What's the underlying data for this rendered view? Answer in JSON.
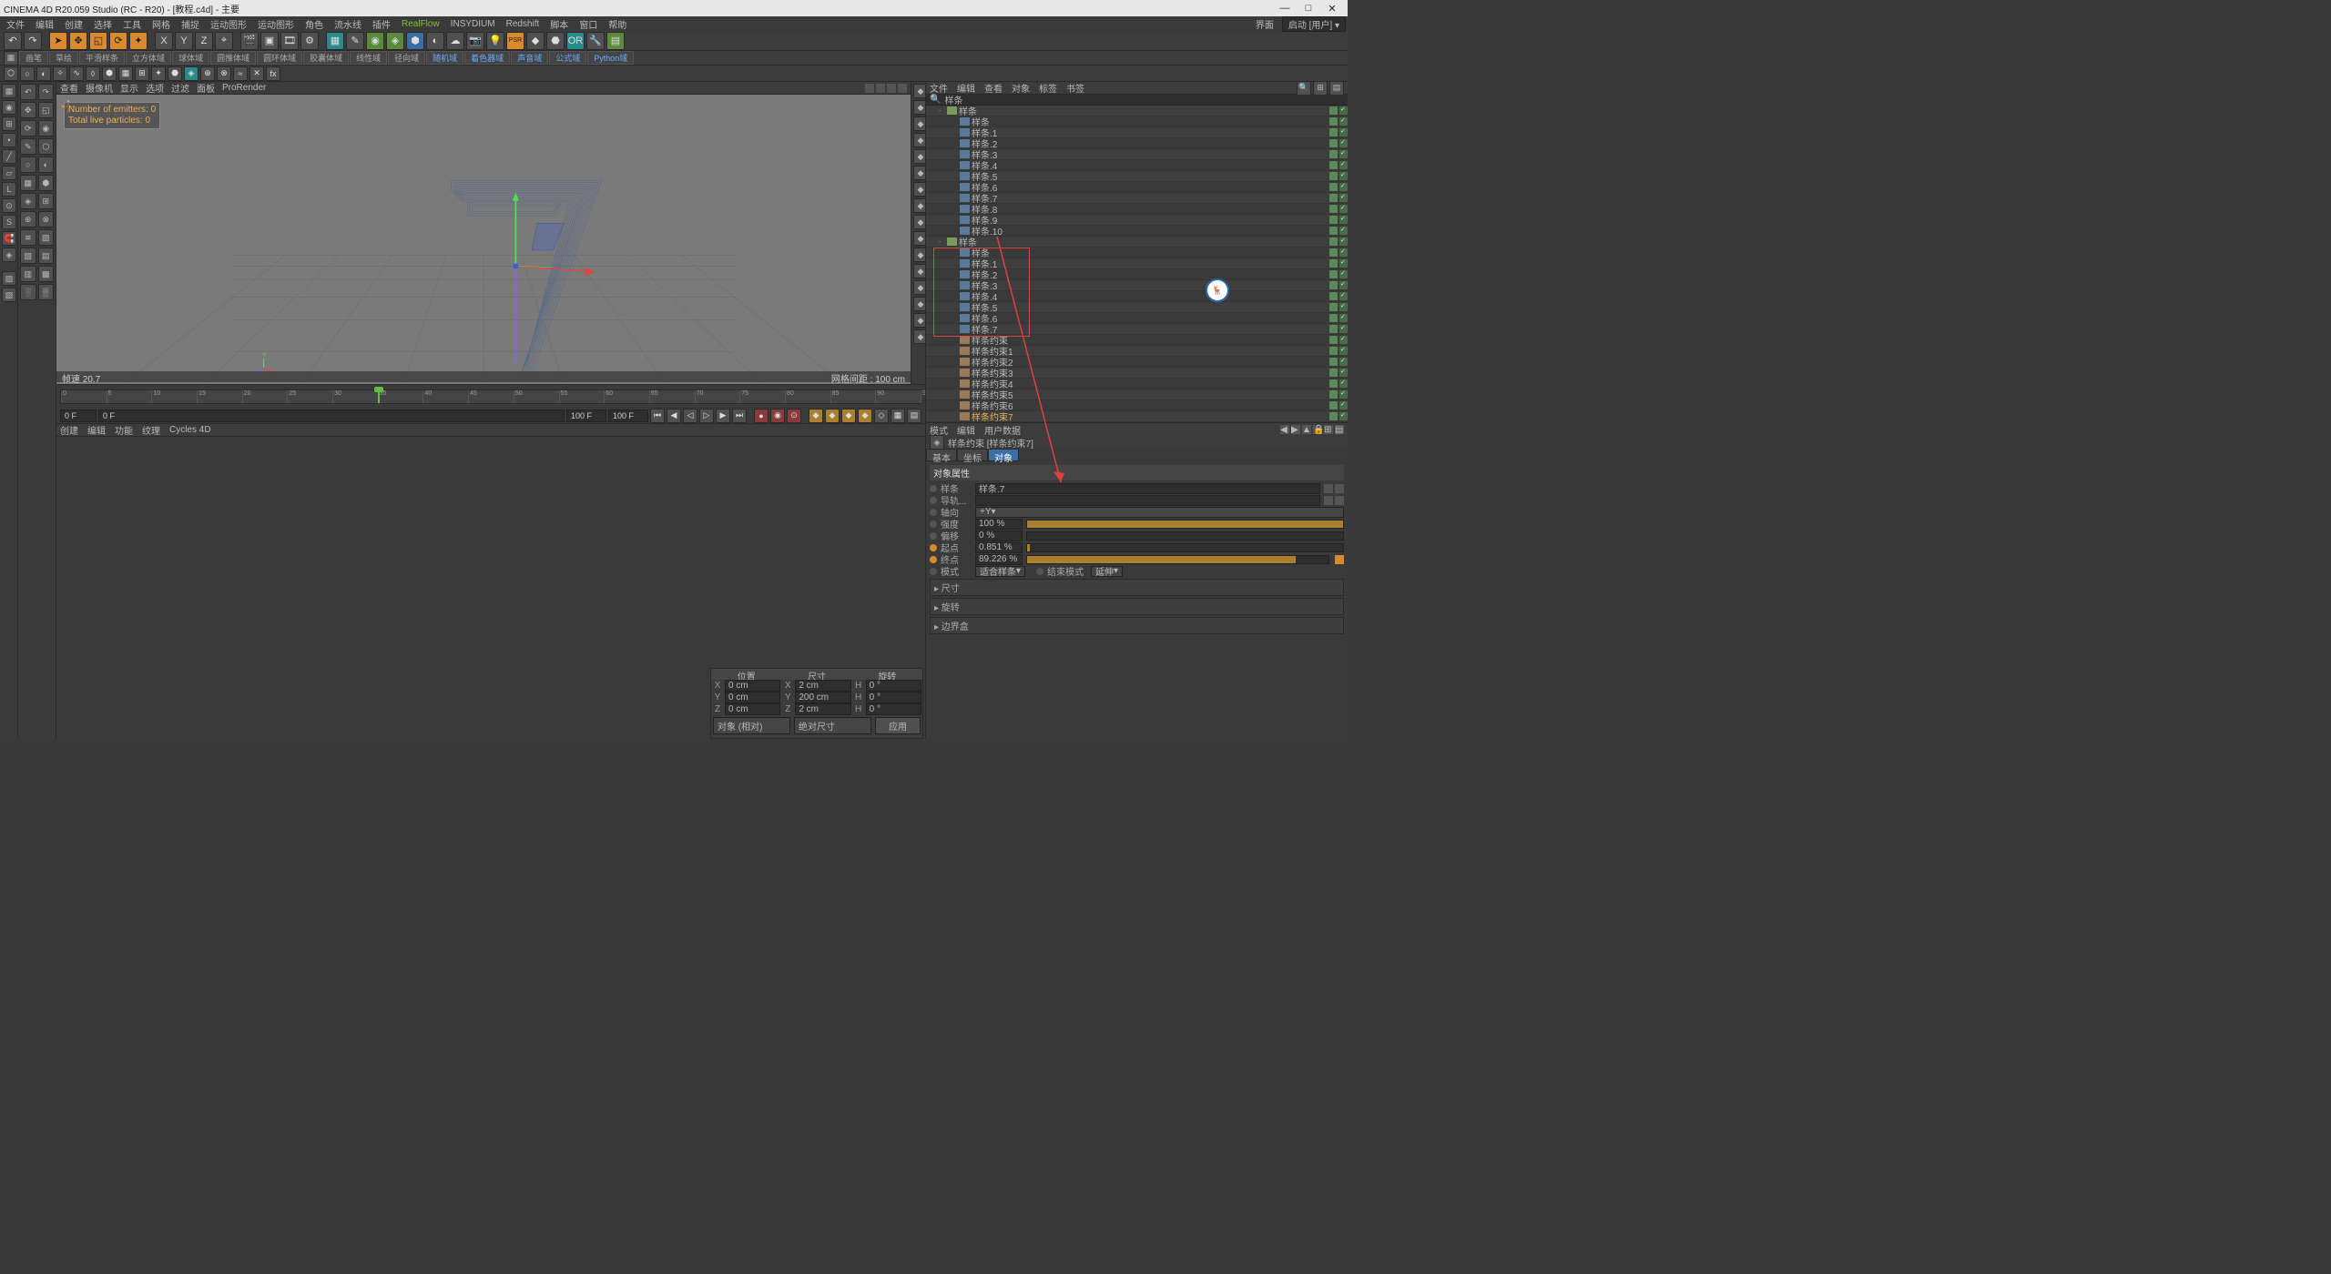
{
  "window": {
    "title": "CINEMA 4D R20.059 Studio (RC - R20) - [教程.c4d] - 主要",
    "btn_min": "—",
    "btn_max": "□",
    "btn_close": "✕"
  },
  "menubar": {
    "items": [
      "文件",
      "编辑",
      "创建",
      "选择",
      "工具",
      "网格",
      "捕捉",
      "运动图形",
      "运动图形",
      "角色",
      "流水线",
      "插件",
      "RealFlow",
      "INSYDIUM",
      "Redshift",
      "脚本",
      "窗口",
      "帮助"
    ],
    "layout_label": "界面",
    "layout_value": "启动 [用户]"
  },
  "splinebar": {
    "items": [
      "画笔",
      "草绘",
      "平滑样条",
      "立方体域",
      "球体域",
      "圆推体域",
      "圆环体域",
      "胶囊体域",
      "线性域",
      "径向域",
      "随机域",
      "着色器域",
      "声音域",
      "公式域",
      "Python域"
    ]
  },
  "viewport": {
    "menu": [
      "查看",
      "摄像机",
      "显示",
      "选项",
      "过滤",
      "面板",
      "ProRender"
    ],
    "info_emitters": "Number of emitters: 0",
    "info_particles": "Total live particles: 0",
    "status_left": "帧速  20.7",
    "status_right": "网格间距 : 100 cm"
  },
  "timeline": {
    "start": 0,
    "end": 95,
    "current": 35,
    "field_start": "0 F",
    "field_cur": "0 F",
    "field_endin": "100 F",
    "field_end": "100 F"
  },
  "bottom_tabs": [
    "创建",
    "编辑",
    "功能",
    "纹理",
    "Cycles 4D"
  ],
  "coord": {
    "hdr": [
      "位置",
      "尺寸",
      "旋转"
    ],
    "rows": [
      {
        "axis": "X",
        "pos": "0 cm",
        "size": "2 cm",
        "rot": "0 °"
      },
      {
        "axis": "Y",
        "pos": "0 cm",
        "size": "200 cm",
        "rot": "0 °"
      },
      {
        "axis": "Z",
        "pos": "0 cm",
        "size": "2 cm",
        "rot": "0 °"
      }
    ],
    "mode1": "对象 (相对)",
    "mode2": "绝对尺寸",
    "apply": "应用"
  },
  "obj_panel": {
    "menu": [
      "文件",
      "编辑",
      "查看",
      "对象",
      "标签",
      "书签"
    ],
    "search": "样条",
    "tree": [
      {
        "d": 0,
        "exp": "-",
        "ic": "grp",
        "nm": "样条",
        "tags": [
          "g",
          "chk"
        ]
      },
      {
        "d": 1,
        "exp": "",
        "ic": "spl",
        "nm": "样条",
        "tags": [
          "g",
          "chk"
        ]
      },
      {
        "d": 1,
        "exp": "",
        "ic": "spl",
        "nm": "样条.1",
        "tags": [
          "g",
          "chk"
        ]
      },
      {
        "d": 1,
        "exp": "",
        "ic": "spl",
        "nm": "样条.2",
        "tags": [
          "g",
          "chk"
        ]
      },
      {
        "d": 1,
        "exp": "",
        "ic": "spl",
        "nm": "样条.3",
        "tags": [
          "g",
          "chk"
        ]
      },
      {
        "d": 1,
        "exp": "",
        "ic": "spl",
        "nm": "样条.4",
        "tags": [
          "g",
          "chk"
        ]
      },
      {
        "d": 1,
        "exp": "",
        "ic": "spl",
        "nm": "样条.5",
        "tags": [
          "g",
          "chk"
        ]
      },
      {
        "d": 1,
        "exp": "",
        "ic": "spl",
        "nm": "样条.6",
        "tags": [
          "g",
          "chk"
        ]
      },
      {
        "d": 1,
        "exp": "",
        "ic": "spl",
        "nm": "样条.7",
        "tags": [
          "g",
          "chk"
        ]
      },
      {
        "d": 1,
        "exp": "",
        "ic": "spl",
        "nm": "样条.8",
        "tags": [
          "g",
          "chk"
        ]
      },
      {
        "d": 1,
        "exp": "",
        "ic": "spl",
        "nm": "样条.9",
        "tags": [
          "g",
          "chk"
        ]
      },
      {
        "d": 1,
        "exp": "",
        "ic": "spl",
        "nm": "样条.10",
        "tags": [
          "g",
          "chk"
        ]
      },
      {
        "d": 0,
        "exp": "-",
        "ic": "grp",
        "nm": "样条",
        "tags": [
          "g",
          "chk"
        ]
      },
      {
        "d": 1,
        "exp": "",
        "ic": "spl",
        "nm": "样条",
        "tags": [
          "g",
          "chk"
        ],
        "box": true
      },
      {
        "d": 1,
        "exp": "",
        "ic": "spl",
        "nm": "样条.1",
        "tags": [
          "g",
          "chk"
        ],
        "box": true
      },
      {
        "d": 1,
        "exp": "",
        "ic": "spl",
        "nm": "样条.2",
        "tags": [
          "g",
          "chk"
        ],
        "box": true
      },
      {
        "d": 1,
        "exp": "",
        "ic": "spl",
        "nm": "样条.3",
        "tags": [
          "g",
          "chk"
        ],
        "box": true
      },
      {
        "d": 1,
        "exp": "",
        "ic": "spl",
        "nm": "样条.4",
        "tags": [
          "g",
          "chk"
        ],
        "box": true
      },
      {
        "d": 1,
        "exp": "",
        "ic": "spl",
        "nm": "样条.5",
        "tags": [
          "g",
          "chk"
        ],
        "box": true
      },
      {
        "d": 1,
        "exp": "",
        "ic": "spl",
        "nm": "样条.6",
        "tags": [
          "g",
          "chk"
        ],
        "box": true
      },
      {
        "d": 1,
        "exp": "",
        "ic": "spl",
        "nm": "样条.7",
        "tags": [
          "g",
          "chk"
        ],
        "box": true
      },
      {
        "d": 1,
        "exp": "",
        "ic": "con",
        "nm": "样条约束",
        "tags": [
          "g",
          "chk"
        ]
      },
      {
        "d": 1,
        "exp": "",
        "ic": "con",
        "nm": "样条约束1",
        "tags": [
          "g",
          "chk"
        ]
      },
      {
        "d": 1,
        "exp": "",
        "ic": "con",
        "nm": "样条约束2",
        "tags": [
          "g",
          "chk"
        ]
      },
      {
        "d": 1,
        "exp": "",
        "ic": "con",
        "nm": "样条约束3",
        "tags": [
          "g",
          "chk"
        ]
      },
      {
        "d": 1,
        "exp": "",
        "ic": "con",
        "nm": "样条约束4",
        "tags": [
          "g",
          "chk"
        ]
      },
      {
        "d": 1,
        "exp": "",
        "ic": "con",
        "nm": "样条约束5",
        "tags": [
          "g",
          "chk"
        ]
      },
      {
        "d": 1,
        "exp": "",
        "ic": "con",
        "nm": "样条约束6",
        "tags": [
          "g",
          "chk"
        ]
      },
      {
        "d": 1,
        "exp": "",
        "ic": "con",
        "nm": "样条约束7",
        "tags": [
          "g",
          "chk"
        ],
        "sel": true
      }
    ]
  },
  "attr": {
    "menu": [
      "模式",
      "编辑",
      "用户数据"
    ],
    "title": "样条约束 [样条约束7]",
    "tabs": [
      "基本",
      "坐标",
      "对象"
    ],
    "section": "对象属性",
    "rows": {
      "spline_lbl": "样条",
      "spline_val": "样条.7",
      "rail_lbl": "导轨...",
      "rail_val": "",
      "axis_lbl": "轴向",
      "axis_val": "+Y",
      "strength_lbl": "强度",
      "strength_val": "100 %",
      "strength_fill": 100,
      "offset_lbl": "偏移",
      "offset_val": "0 %",
      "offset_fill": 0,
      "start_lbl": "起点",
      "start_val": "0.851 %",
      "start_fill": 0.85,
      "end_lbl": "终点",
      "end_val": "89.226 %",
      "end_fill": 89.2,
      "mode_lbl": "模式",
      "mode_val": "适合样条",
      "endmode_lbl": "结束模式",
      "endmode_val": "延伸"
    },
    "collapse": [
      "▸ 尺寸",
      "▸ 旋转",
      "▸ 边界盒"
    ]
  },
  "watermark": "🦌"
}
